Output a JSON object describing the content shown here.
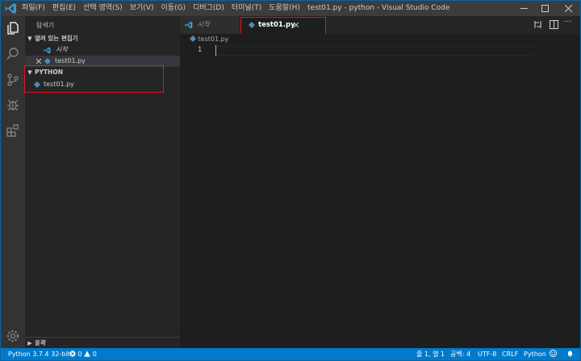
{
  "window": {
    "title": "test01.py - python - Visual Studio Code",
    "menu": [
      "파일(F)",
      "편집(E)",
      "선택 영역(S)",
      "보기(V)",
      "이동(G)",
      "디버그(D)",
      "터미널(T)",
      "도움말(H)"
    ]
  },
  "sidebar": {
    "title": "탐색기",
    "open_editors": {
      "label": "열려 있는 편집기",
      "items": [
        {
          "label": "시작"
        },
        {
          "label": "test01.py"
        }
      ]
    },
    "folder": {
      "label": "PYTHON",
      "items": [
        {
          "label": "test01.py"
        }
      ]
    },
    "outline": {
      "label": "윤곽"
    }
  },
  "tabs": [
    {
      "label": "시작",
      "active": false
    },
    {
      "label": "test01.py",
      "active": true
    }
  ],
  "editor": {
    "breadcrumb": "test01.py",
    "line_numbers": [
      "1"
    ]
  },
  "statusbar": {
    "interpreter": "Python 3.7.4 32-bit",
    "errors": "0",
    "warnings": "0",
    "position": "줄 1, 열 1",
    "indent": "공백: 4",
    "encoding": "UTF-8",
    "eol": "CRLF",
    "language": "Python"
  },
  "colors": {
    "accent": "#007acc",
    "highlight": "#e81123",
    "vscode_blue": "#3c99d4",
    "python_blue": "#4b8bbe"
  }
}
